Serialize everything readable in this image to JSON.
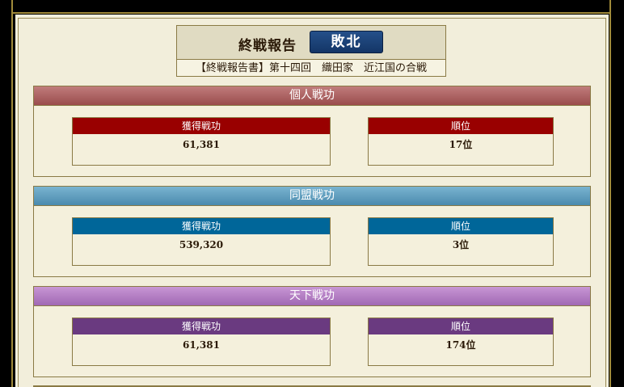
{
  "header": {
    "title": "終戦報告",
    "result": "敗北",
    "subtitle": "【終戦報告書】第十四回　織田家　近江国の合戦"
  },
  "sections": [
    {
      "title": "個人戦功",
      "color": "#a85a5a",
      "stat_color": "#990000",
      "stats": [
        {
          "label": "獲得戦功",
          "value": "61,381"
        },
        {
          "label": "順位",
          "value": "17位"
        }
      ]
    },
    {
      "title": "同盟戦功",
      "color": "#5a98bb",
      "stat_color": "#006699",
      "stats": [
        {
          "label": "獲得戦功",
          "value": "539,320"
        },
        {
          "label": "順位",
          "value": "3位"
        }
      ]
    },
    {
      "title": "天下戦功",
      "color": "#b078c0",
      "stat_color": "#6a3a80",
      "stats": [
        {
          "label": "獲得戦功",
          "value": "61,381"
        },
        {
          "label": "順位",
          "value": "174位"
        }
      ]
    }
  ]
}
